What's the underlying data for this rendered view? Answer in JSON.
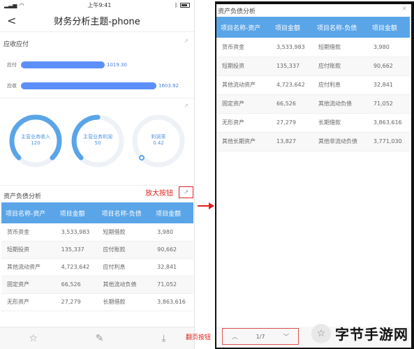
{
  "status": {
    "time": "上午9:41"
  },
  "nav": {
    "title": "财务分析主题-phone",
    "back": "<"
  },
  "receivable": {
    "title": "应收应付",
    "rows": [
      {
        "label": "应付",
        "value": "1019.30",
        "frac": 0.62
      },
      {
        "label": "应收",
        "value": "1603.92",
        "frac": 0.98
      }
    ]
  },
  "gauges": [
    {
      "label": "主营业务收入",
      "value": "120",
      "fraction": 0.95
    },
    {
      "label": "主营业务利润",
      "value": "50",
      "fraction": 0.42
    },
    {
      "label": "利润率",
      "value": "0.42",
      "fraction": 0.06
    }
  ],
  "balance": {
    "title": "资产负债分析",
    "enlarge_label": "放大按钮",
    "headers": [
      "项目名称-资产",
      "项目金额",
      "项目名称-负债",
      "项目金额"
    ],
    "rows": [
      [
        "货币资金",
        "3,533,983",
        "短期借款",
        "3,980"
      ],
      [
        "短期投资",
        "135,337",
        "应付账款",
        "90,662"
      ],
      [
        "其他流动资产",
        "4,723,642",
        "应付利息",
        "32,841"
      ],
      [
        "固定资产",
        "66,526",
        "其他流动负债",
        "71,052"
      ],
      [
        "无形资产",
        "27,279",
        "长期借款",
        "3,863,616"
      ],
      [
        "其他长期资产",
        "13,827",
        "其他非流动负债",
        "3,771,030"
      ]
    ]
  },
  "modal": {
    "title": "资产负债分析",
    "pager_label": "翻页按钮",
    "page": "1/7"
  },
  "watermark": {
    "text": "字节手游网"
  },
  "colors": {
    "accent": "#5aa5e8",
    "bar": "#5b8ff9",
    "annotation": "#e02020"
  }
}
